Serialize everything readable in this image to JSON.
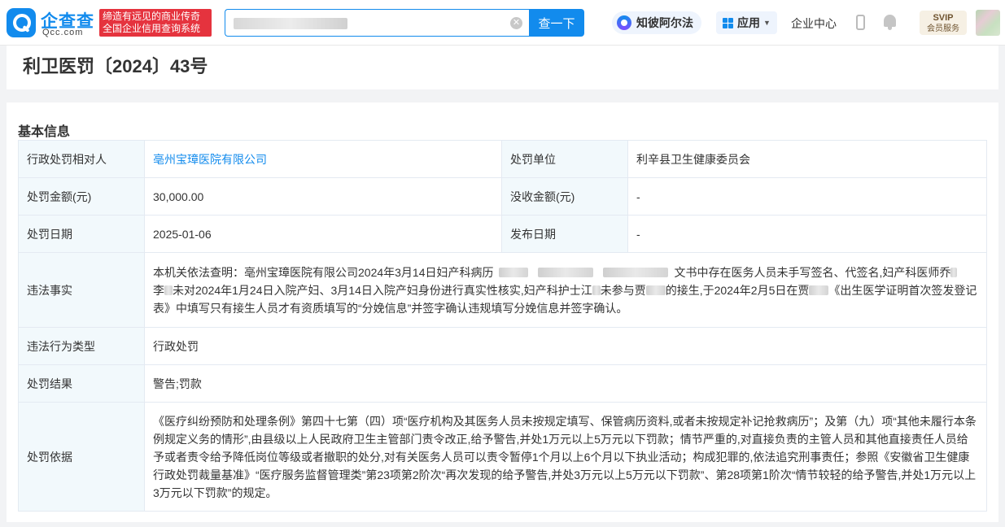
{
  "header": {
    "logo_name": "企查查",
    "logo_domain": "Qcc.com",
    "slogan_line1": "缔造有远见的商业传奇",
    "slogan_line2": "全国企业信用查询系统",
    "search_placeholder": "",
    "search_button": "查一下",
    "zhibi_label": "知彼阿尔法",
    "app_label": "应用",
    "enterprise_center": "企业中心",
    "svip_top": "SVIP",
    "svip_bottom": "会员服务"
  },
  "page": {
    "title": "利卫医罚〔2024〕43号"
  },
  "basic_info": {
    "section_title": "基本信息",
    "party_label": "行政处罚相对人",
    "party_value": "亳州宝璋医院有限公司",
    "unit_label": "处罚单位",
    "unit_value": "利辛县卫生健康委员会",
    "amount_label": "处罚金额(元)",
    "amount_value": "30,000.00",
    "confiscated_label": "没收金额(元)",
    "confiscated_value": "-",
    "date_label": "处罚日期",
    "date_value": "2025-01-06",
    "publish_label": "发布日期",
    "publish_value": "-",
    "facts_label": "违法事实",
    "facts_p1": "本机关依法查明：亳州宝璋医院有限公司2024年3月14日妇产科病历",
    "facts_p2": "文书中存在医务人员未手写签名、代签名,妇产科医师乔",
    "facts_p3": "李",
    "facts_p4": "未对2024年1月24日入院产妇、3月14日入院产妇身份进行真实性核实,妇产科护士江",
    "facts_p5": "未参与贾",
    "facts_p6": "的接生,于2024年2月5日在贾",
    "facts_p7": "《出生医学证明首次签发登记表》中填写只有接生人员才有资质填写的“分娩信息”并签字确认违规填写分娩信息并签字确认。",
    "type_label": "违法行为类型",
    "type_value": "行政处罚",
    "result_label": "处罚结果",
    "result_value": "警告;罚款",
    "basis_label": "处罚依据",
    "basis_value": "《医疗纠纷预防和处理条例》第四十七第（四）项“医疗机构及其医务人员未按规定填写、保管病历资料,或者未按规定补记抢救病历”；及第（九）项“其他未履行本条例规定义务的情形”,由县级以上人民政府卫生主管部门责令改正,给予警告,并处1万元以上5万元以下罚款；情节严重的,对直接负责的主管人员和其他直接责任人员给予或者责令给予降低岗位等级或者撤职的处分,对有关医务人员可以责令暂停1个月以上6个月以下执业活动；构成犯罪的,依法追究刑事责任；参照《安徽省卫生健康行政处罚裁量基准》“医疗服务监督管理类”第23项第2阶次“再次发现的给予警告,并处3万元以上5万元以下罚款”、第28项第1阶次“情节较轻的给予警告,并处1万元以上3万元以下罚款”的规定。"
  },
  "colors": {
    "brand": "#128bed",
    "slogan_bg": "#e5333e",
    "label_bg": "#f2f9fc",
    "page_bg": "#f2f3f5"
  }
}
